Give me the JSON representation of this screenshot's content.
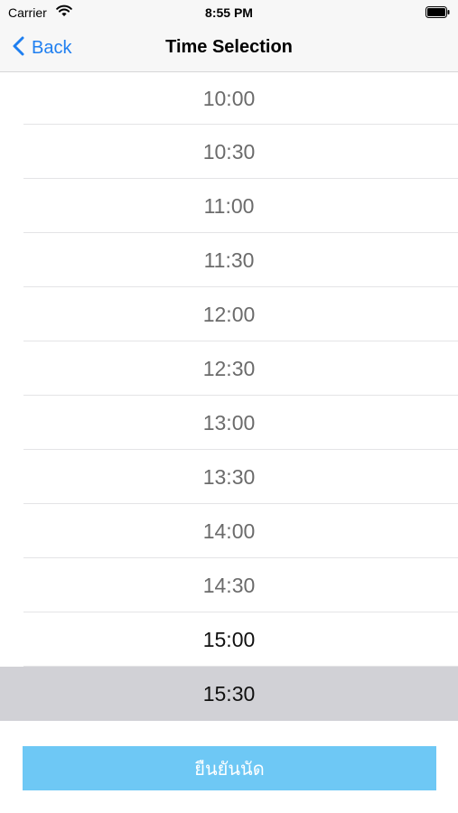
{
  "status_bar": {
    "carrier": "Carrier",
    "time": "8:55 PM",
    "wifi_icon": "wifi-icon",
    "battery_icon": "battery-icon"
  },
  "nav": {
    "back_label": "Back",
    "back_icon": "chevron-left-icon",
    "title": "Time Selection",
    "accent_color": "#1f7ff0"
  },
  "time_slots": [
    {
      "label": "10:00",
      "state": "unavailable"
    },
    {
      "label": "10:30",
      "state": "unavailable"
    },
    {
      "label": "11:00",
      "state": "unavailable"
    },
    {
      "label": "11:30",
      "state": "unavailable"
    },
    {
      "label": "12:00",
      "state": "unavailable"
    },
    {
      "label": "12:30",
      "state": "unavailable"
    },
    {
      "label": "13:00",
      "state": "unavailable"
    },
    {
      "label": "13:30",
      "state": "unavailable"
    },
    {
      "label": "14:00",
      "state": "unavailable"
    },
    {
      "label": "14:30",
      "state": "unavailable"
    },
    {
      "label": "15:00",
      "state": "available"
    },
    {
      "label": "15:30",
      "state": "selected"
    }
  ],
  "colors": {
    "unavailable_text": "#6b6b6b",
    "available_text": "#111111",
    "selected_background": "#d1d1d6",
    "confirm_button": "#6ec8f5"
  },
  "confirm_button": {
    "label": "ยืนยันนัด"
  }
}
